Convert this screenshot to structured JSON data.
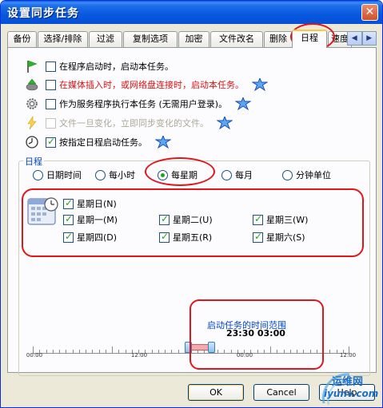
{
  "window": {
    "title": "设置同步任务",
    "close_glyph": "✕"
  },
  "tabs": [
    {
      "label": "备份"
    },
    {
      "label": "选择/排除"
    },
    {
      "label": "过滤"
    },
    {
      "label": "复制选项"
    },
    {
      "label": "加密"
    },
    {
      "label": "文件改名"
    },
    {
      "label": "删除"
    },
    {
      "label": "日程",
      "active": true
    },
    {
      "label": "速度"
    }
  ],
  "tab_scroll": {
    "left": "◀",
    "right": "▶"
  },
  "options": [
    {
      "label": "在程序启动时，启动本任务。",
      "checked": false,
      "style": "normal",
      "icon": "green-flag-icon"
    },
    {
      "label": "在媒体插入时，或网络盘连接时，启动本任务。",
      "checked": false,
      "style": "red",
      "icon": "media-insert-icon"
    },
    {
      "label": "作为服务程序执行本任务 (无需用户登录)。",
      "checked": false,
      "style": "normal",
      "icon": "gear-service-icon"
    },
    {
      "label": "文件一旦变化，立即同步变化的文件。",
      "checked": false,
      "style": "disabled",
      "icon": "lightning-icon"
    },
    {
      "label": "按指定日程启动任务。",
      "checked": true,
      "style": "normal",
      "icon": "clock-icon"
    }
  ],
  "schedule": {
    "group_title": "日程",
    "radios": [
      {
        "label": "日期时间",
        "selected": false
      },
      {
        "label": "每小时",
        "selected": false
      },
      {
        "label": "每星期",
        "selected": true
      },
      {
        "label": "每月",
        "selected": false
      },
      {
        "label": "分钟单位",
        "selected": false
      }
    ],
    "days": [
      {
        "label": "星期日(N)",
        "checked": true
      },
      {
        "label": "星期一(M)",
        "checked": true
      },
      {
        "label": "星期二(U)",
        "checked": true
      },
      {
        "label": "星期三(W)",
        "checked": true
      },
      {
        "label": "星期四(D)",
        "checked": true
      },
      {
        "label": "星期五(R)",
        "checked": true
      },
      {
        "label": "星期六(S)",
        "checked": true
      }
    ]
  },
  "timeline": {
    "title": "启动任务的时间范围",
    "start_time": "23:30",
    "end_time": "03:00",
    "labels": [
      "00:00",
      "12:00",
      "00:00",
      "12:00"
    ],
    "range_start_hours": 23.5,
    "range_end_hours": 27.0,
    "span_hours": 48
  },
  "buttons": {
    "ok": "OK",
    "cancel": "Cancel",
    "help": "Help"
  },
  "watermark": {
    "line1": "运维网",
    "line2": "iyunv.com"
  },
  "colors": {
    "titlebar": "#0758df",
    "highlight": "#e0161b",
    "group_title": "#0046d5",
    "check": "#21a121"
  }
}
